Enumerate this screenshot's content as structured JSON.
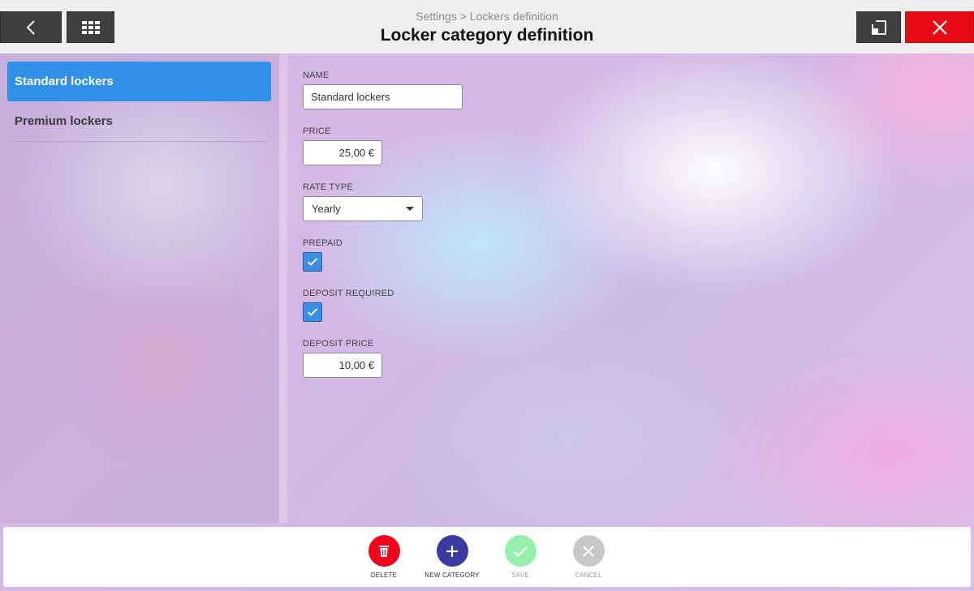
{
  "header": {
    "breadcrumb": "Settings > Lockers definition",
    "title": "Locker category definition",
    "back_icon": "chevron-left-icon",
    "apps_icon": "grid-icon",
    "restore_icon": "window-restore-icon",
    "close_icon": "close-icon",
    "close_color": "#e50a14"
  },
  "sidebar": {
    "items": [
      {
        "label": "Standard lockers",
        "active": true
      },
      {
        "label": "Premium lockers",
        "active": false
      }
    ],
    "active_color": "#3191ea"
  },
  "form": {
    "name": {
      "label": "NAME",
      "value": "Standard lockers"
    },
    "price": {
      "label": "PRICE",
      "value": "25,00 €"
    },
    "rate_type": {
      "label": "RATE TYPE",
      "value": "Yearly"
    },
    "prepaid": {
      "label": "PREPAID",
      "checked": true
    },
    "deposit_required": {
      "label": "DEPOSIT REQUIRED",
      "checked": true
    },
    "deposit_price": {
      "label": "DEPOSIT PRICE",
      "value": "10,00 €"
    }
  },
  "footer": {
    "actions": [
      {
        "label": "DELETE",
        "icon": "trash-icon",
        "color": "#f0061a",
        "enabled": true
      },
      {
        "label": "NEW CATEGORY",
        "icon": "plus-icon",
        "color": "#3a3aa0",
        "enabled": true
      },
      {
        "label": "SAVE",
        "icon": "check-icon",
        "color": "#97efae",
        "enabled": false
      },
      {
        "label": "CANCEL",
        "icon": "close-icon",
        "color": "#c8c8c8",
        "enabled": false
      }
    ]
  }
}
